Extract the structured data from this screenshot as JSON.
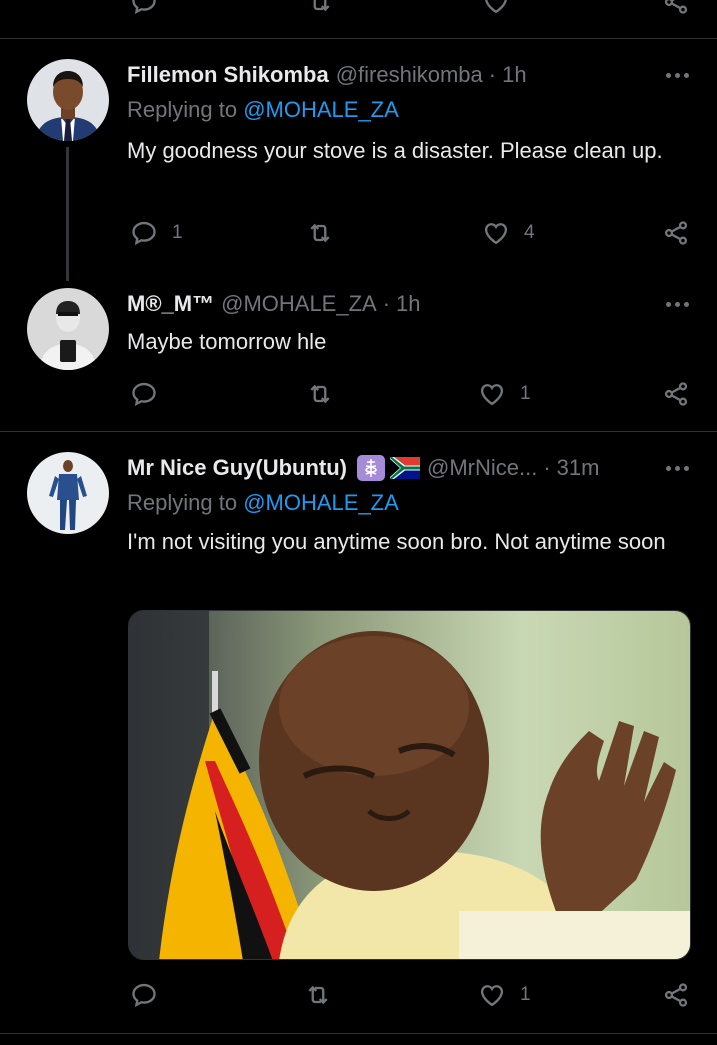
{
  "tweets": [
    {
      "name": "Fillemon Shikomba",
      "handle": "@fireshikomba",
      "time": "1h",
      "replying_label": "Replying to",
      "replying_to": "@MOHALE_ZA",
      "text": "My goodness your stove is a disaster. Please clean up.",
      "reply_count": "1",
      "retweet_count": "",
      "like_count": "4"
    },
    {
      "name": "M®_M™",
      "handle": "@MOHALE_ZA",
      "time": "1h",
      "text": "Maybe tomorrow hle",
      "reply_count": "",
      "retweet_count": "",
      "like_count": "1"
    },
    {
      "name": "Mr Nice Guy(Ubuntu)",
      "handle": "@MrNice...",
      "time": "31m",
      "replying_label": "Replying to",
      "replying_to": "@MOHALE_ZA",
      "text": "I'm not visiting you anytime soon bro. Not anytime soon",
      "reply_count": "",
      "retweet_count": "",
      "like_count": "1"
    }
  ],
  "separator": "·",
  "icons": {
    "reply": "reply-icon",
    "retweet": "retweet-icon",
    "like": "heart-icon",
    "share": "share-icon",
    "more": "more-icon"
  },
  "colors": {
    "background": "#000000",
    "text": "#e7e9ea",
    "muted": "#71767b",
    "accent": "#1d9bf0",
    "divider": "#2f3336"
  }
}
